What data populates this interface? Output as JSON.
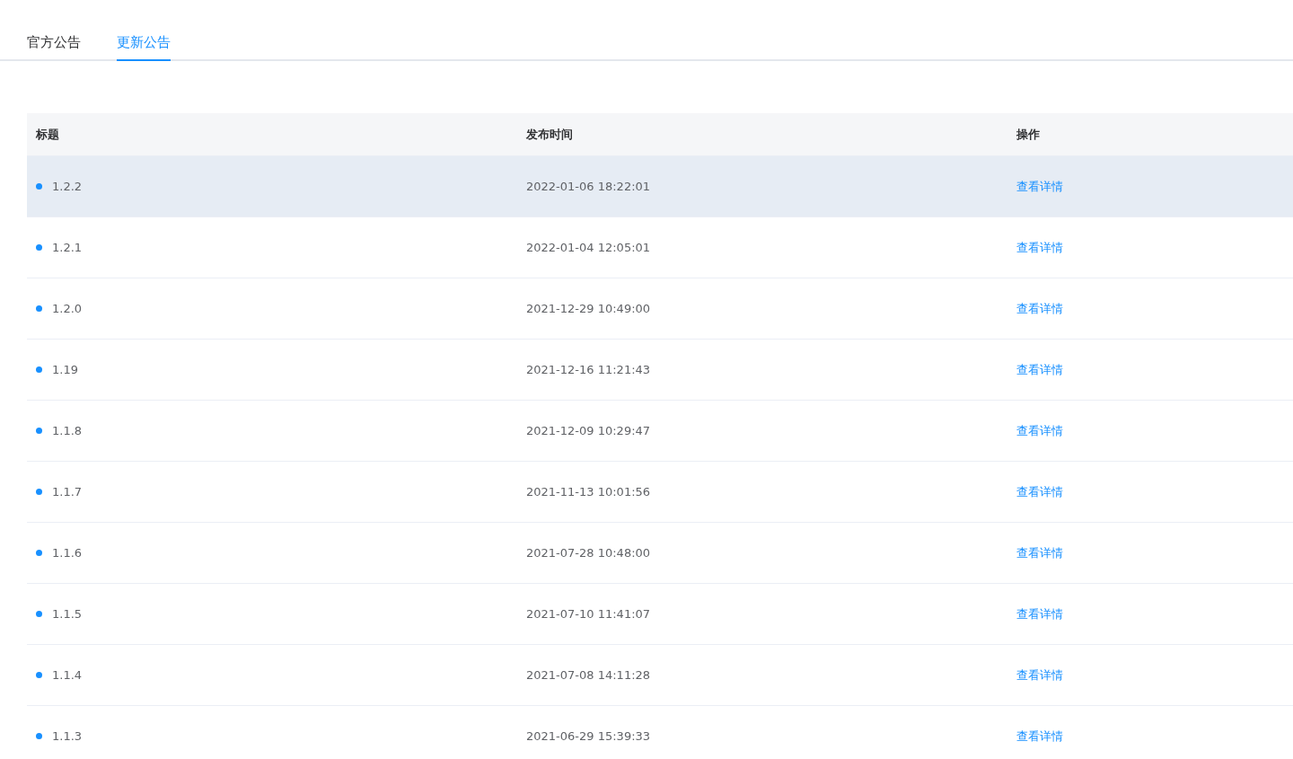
{
  "tabs": [
    {
      "label": "官方公告",
      "selected": false
    },
    {
      "label": "更新公告",
      "selected": true
    }
  ],
  "table": {
    "columns": [
      "标题",
      "发布时间",
      "操作"
    ],
    "rows": [
      {
        "title": "1.2.2",
        "time": "2022-01-06 18:22:01",
        "action": "查看详情",
        "highlighted": true
      },
      {
        "title": "1.2.1",
        "time": "2022-01-04 12:05:01",
        "action": "查看详情",
        "highlighted": false
      },
      {
        "title": "1.2.0",
        "time": "2021-12-29 10:49:00",
        "action": "查看详情",
        "highlighted": false
      },
      {
        "title": "1.19",
        "time": "2021-12-16 11:21:43",
        "action": "查看详情",
        "highlighted": false
      },
      {
        "title": "1.1.8",
        "time": "2021-12-09 10:29:47",
        "action": "查看详情",
        "highlighted": false
      },
      {
        "title": "1.1.7",
        "time": "2021-11-13 10:01:56",
        "action": "查看详情",
        "highlighted": false
      },
      {
        "title": "1.1.6",
        "time": "2021-07-28 10:48:00",
        "action": "查看详情",
        "highlighted": false
      },
      {
        "title": "1.1.5",
        "time": "2021-07-10 11:41:07",
        "action": "查看详情",
        "highlighted": false
      },
      {
        "title": "1.1.4",
        "time": "2021-07-08 14:11:28",
        "action": "查看详情",
        "highlighted": false
      },
      {
        "title": "1.1.3",
        "time": "2021-06-29 15:39:33",
        "action": "查看详情",
        "highlighted": false
      }
    ]
  }
}
